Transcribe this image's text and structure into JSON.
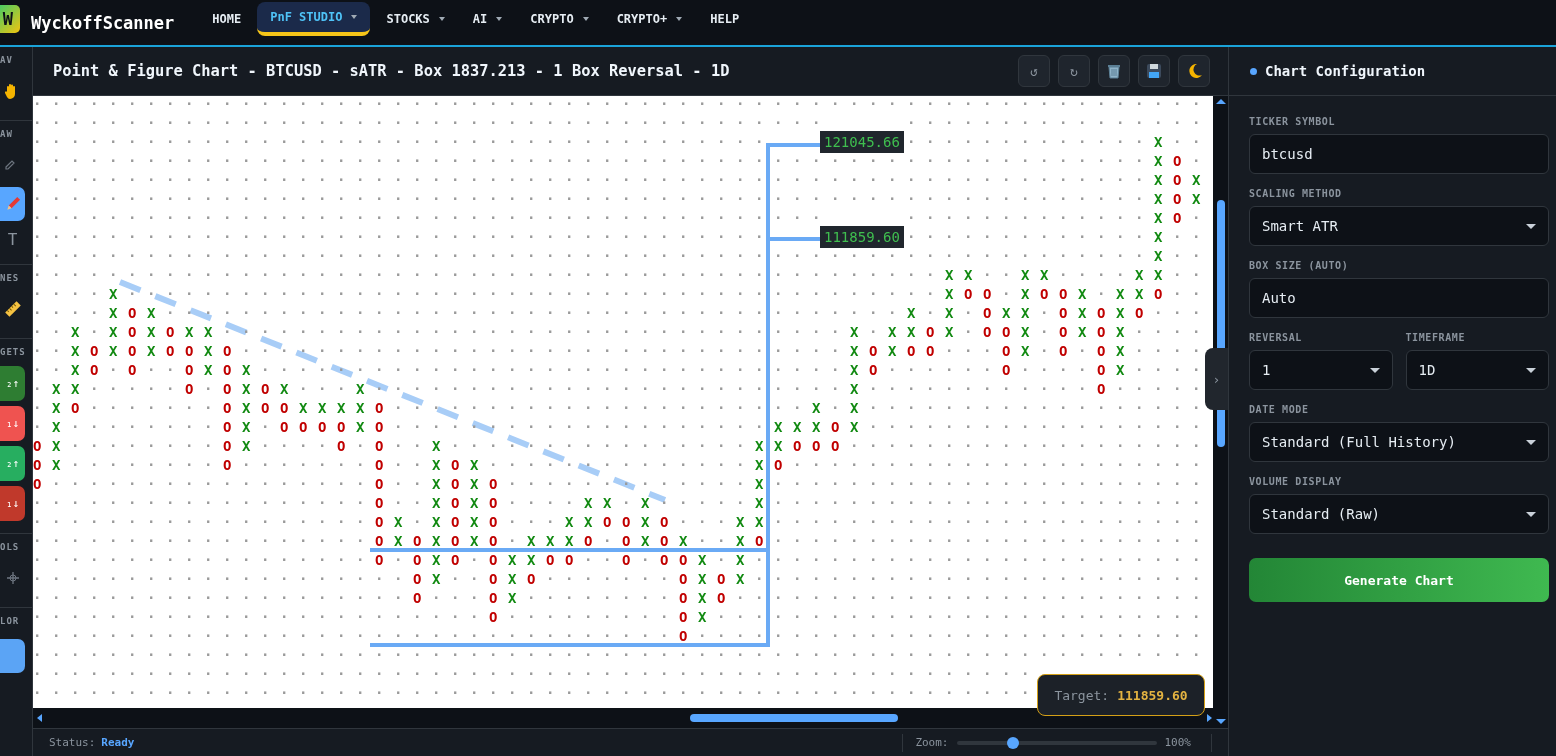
{
  "nav": {
    "logo": "W",
    "brand": "WyckoffScanner",
    "items": [
      {
        "label": "HOME",
        "selected": false,
        "dropdown": false
      },
      {
        "label": "PnF STUDIO",
        "selected": true,
        "dropdown": true
      },
      {
        "label": "STOCKS",
        "selected": false,
        "dropdown": true
      },
      {
        "label": "AI",
        "selected": false,
        "dropdown": true
      },
      {
        "label": "CRYPTO",
        "selected": false,
        "dropdown": true
      },
      {
        "label": "CRYPTO+",
        "selected": false,
        "dropdown": true
      },
      {
        "label": "HELP",
        "selected": false,
        "dropdown": false
      }
    ]
  },
  "toolbar": [
    {
      "label": "AV",
      "tools": [
        {
          "kind": "icon",
          "selected": false
        }
      ]
    },
    {
      "label": "AW",
      "tools": [
        {
          "kind": "icon",
          "selected": false
        },
        {
          "kind": "icon",
          "selected": true
        },
        {
          "kind": "text",
          "text": "T",
          "selected": false
        }
      ]
    },
    {
      "label": "NES",
      "tools": [
        {
          "kind": "icon",
          "selected": false
        }
      ]
    },
    {
      "label": "GETS",
      "tools": [
        {
          "kind": "target",
          "text": "₂↑",
          "color": "#2e7d32"
        },
        {
          "kind": "target",
          "text": "₁↓",
          "color": "#ef5350"
        },
        {
          "kind": "target",
          "text": "₂↑",
          "color": "#27ae60"
        },
        {
          "kind": "target",
          "text": "₁↓",
          "color": "#c0392b"
        }
      ]
    },
    {
      "label": "OLS",
      "tools": [
        {
          "kind": "icon",
          "selected": false
        }
      ]
    },
    {
      "label": "LOR",
      "tools": [
        {
          "kind": "swatch",
          "color": "#5ba4f5"
        }
      ]
    }
  ],
  "chart": {
    "title": "Point & Figure Chart - BTCUSD - sATR - Box 1837.213 - 1 Box Reversal - 1D",
    "actions": [
      {
        "kind": "text",
        "text": "↺"
      },
      {
        "kind": "text",
        "text": "↻"
      },
      {
        "kind": "icon"
      },
      {
        "kind": "icon"
      },
      {
        "kind": "icon"
      }
    ],
    "grid_rows": [
      [
        ".............................................................."
      ],
      [
        "..........................................    ................"
      ],
      [
        ".......................................",
        ".............X.."
      ],
      [
        "...........................................................XO."
      ],
      [
        "...........................................................XOX"
      ],
      [
        "...........................................................XOX"
      ],
      [
        "..........................................    .............XO."
      ],
      [
        ".......................................",
        ".............X.."
      ],
      [
        "...........................................................X.."
      ],
      [
        "................................................XX..XX....XX.."
      ],
      [
        "....X...........................................XOO.XOOX.XXO.."
      ],
      [
        "....XOX.......................................X.X.OXX.OXOXO..."
      ],
      [
        "..X.XOXOXX.................................X.XXOX.OOX.OXOX...."
      ],
      [
        "..XOXOXOOXO................................XOXOO...OX.O.OX...."
      ],
      [
        "..XO.O..OXOX...............................XO......O....OX...."
      ],
      [
        ".XX.....O.OXOX...X.........................X............O....."
      ],
      [
        ".XO.......OXOOXXXXO......................X.X.................."
      ],
      [
        ".X........OX.OOOOXO....................XXXOX.................."
      ],
      [
        "OX........OX....O.O..X................XXOOO..................."
      ],
      [
        "OX........O.......O..XOX..............XO......................"
      ],
      [
        "O.................O..XOXO.............X......................."
      ],
      [
        "..................O..XOXO....XX.X.....X......................."
      ],
      [
        "..................OX.XOXO...XXOOXO...XX......................."
      ],
      [
        "..................OXOXOXO.XXXO.OXOX..XO......................."
      ],
      [
        "..................O.OXO.OXXOO..O.OOX.X........................"
      ],
      [
        "....................OX..OXO.......OXOX........................"
      ],
      [
        "....................O...OX........OXO........................."
      ],
      [
        "........................O.........OX.........................."
      ],
      [
        "..................................O..........................."
      ],
      [
        ".............................................................."
      ],
      [
        "....................................................."
      ],
      [
        "....................................................."
      ]
    ],
    "price_labels": [
      "121045.66",
      "111859.60"
    ],
    "target": {
      "label": "Target:",
      "value": "111859.60"
    },
    "handle": "›"
  },
  "status": {
    "label": "Status:",
    "value": "Ready",
    "zoom_label": "Zoom:",
    "level": 0.28,
    "reading": "100%"
  },
  "config": {
    "title": "Chart Configuration",
    "fields": [
      {
        "kind": "input",
        "label": "TICKER SYMBOL",
        "value": "btcusd"
      },
      {
        "kind": "select",
        "label": "SCALING METHOD",
        "value": "Smart ATR"
      },
      {
        "kind": "input",
        "label": "BOX SIZE (AUTO)",
        "value": "Auto"
      },
      {
        "kind": "pair",
        "items": [
          {
            "kind": "select",
            "label": "REVERSAL",
            "value": "1"
          },
          {
            "kind": "select",
            "label": "TIMEFRAME",
            "value": "1D"
          }
        ]
      },
      {
        "kind": "select",
        "label": "DATE MODE",
        "value": "Standard (Full History)"
      },
      {
        "kind": "select",
        "label": "VOLUME DISPLAY",
        "value": "Standard (Raw)"
      }
    ],
    "button": "Generate Chart"
  }
}
